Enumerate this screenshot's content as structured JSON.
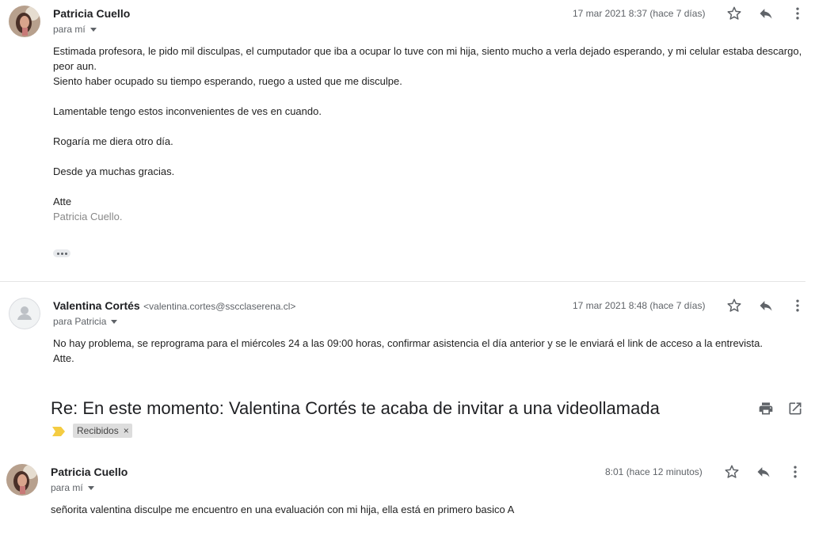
{
  "messages": [
    {
      "sender": "Patricia Cuello",
      "email": "",
      "to": "para mí",
      "date": "17 mar 2021 8:37 (hace 7 días)",
      "paragraphs": [
        "Estimada profesora, le pido mil disculpas, el cumputador que iba a ocupar lo tuve con mi hija, siento mucho a verla dejado esperando, y mi celular estaba descargo, peor aun.",
        "Siento haber ocupado su tiempo esperando, ruego a usted que me disculpe.",
        "Lamentable tengo estos inconvenientes de ves en cuando.",
        "Rogaría me diera otro día.",
        "Desde ya muchas gracias.",
        "Atte"
      ],
      "signature": "Patricia Cuello."
    },
    {
      "sender": "Valentina Cortés",
      "email": "<valentina.cortes@sscclaserena.cl>",
      "to": "para Patricia",
      "date": "17 mar 2021 8:48 (hace 7 días)",
      "paragraphs": [
        "No hay problema, se reprograma para el miércoles 24 a las 09:00 horas,  confirmar asistencia el día anterior y se le enviará el link de acceso a la entrevista.",
        "Atte."
      ]
    },
    {
      "sender": "Patricia Cuello",
      "to": "para mí",
      "date": "8:01 (hace 12 minutos)",
      "paragraphs": [
        "señorita valentina disculpe me encuentro en una evaluación con mi hija, ella está en primero basico A"
      ]
    }
  ],
  "thread": {
    "subject": "Re: En este momento: Valentina Cortés te acaba de invitar a una videollamada",
    "label": "Recibidos",
    "label_remove": "×"
  },
  "icons": {
    "star": "star-icon",
    "reply": "reply-icon",
    "more": "more-vert-icon",
    "print": "print-icon",
    "open_new": "open-in-new-icon",
    "importance": "importance-marker-icon"
  },
  "colors": {
    "importance": "#f4cc42",
    "icon": "#5f6368"
  }
}
